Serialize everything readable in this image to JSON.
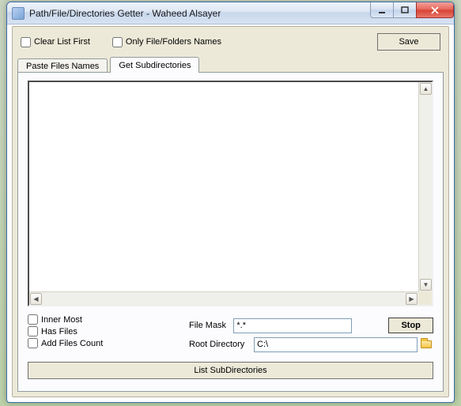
{
  "window": {
    "title": "Path/File/Directories Getter - Waheed Alsayer"
  },
  "toprow": {
    "clear_list_first": "Clear List First",
    "only_file_folders": "Only File/Folders Names",
    "save": "Save"
  },
  "tabs": {
    "paste_files": "Paste Files Names",
    "get_subdirs": "Get Subdirectories"
  },
  "options": {
    "inner_most": "Inner Most",
    "has_files": "Has Files",
    "add_files_count": "Add Files Count"
  },
  "fields": {
    "file_mask_label": "File Mask",
    "file_mask_value": "*.*",
    "root_dir_label": "Root Directory",
    "root_dir_value": "C:\\"
  },
  "buttons": {
    "stop": "Stop",
    "list_subdirs": "List SubDirectories"
  }
}
